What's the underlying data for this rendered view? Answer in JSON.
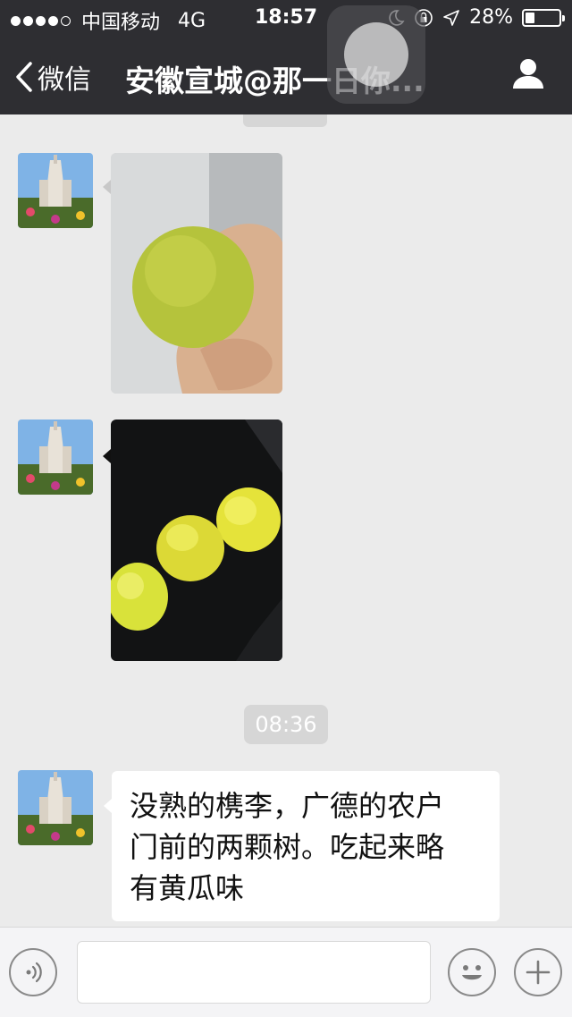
{
  "status_bar": {
    "carrier": "中国移动",
    "network": "4G",
    "time": "18:57",
    "battery": "28%",
    "battery_level": 0.28
  },
  "nav": {
    "back_label": "微信",
    "title": "安徽宣城@那一日你..."
  },
  "messages": [
    {
      "type": "image",
      "depicts": "green plum held in hand"
    },
    {
      "type": "image",
      "depicts": "three yellow plums on dark surface"
    },
    {
      "type": "time",
      "text": "08:36"
    },
    {
      "type": "text",
      "lines": [
        "没熟的槜李，广德的农户",
        "门前的两颗树。吃起来略",
        "有黄瓜味"
      ]
    }
  ],
  "input_bar": {
    "voice_icon": "voice-icon",
    "emoji_icon": "emoji-icon",
    "plus_icon": "plus-icon"
  },
  "colors": {
    "header_bg": "#2e2e32",
    "chat_bg": "#ebebeb",
    "bubble_bg": "#ffffff"
  }
}
